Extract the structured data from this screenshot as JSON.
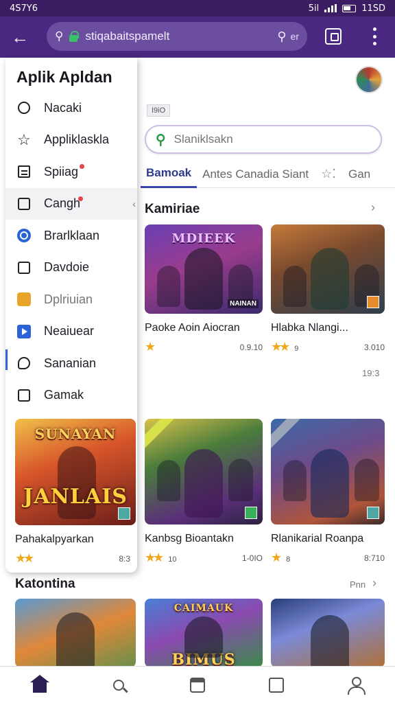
{
  "status": {
    "time": "4S7Y6",
    "clock": "11SD",
    "signal": "5il"
  },
  "toolbar": {
    "url": "stiqabaitspamelt",
    "url_suffix": "er"
  },
  "drawer": {
    "title": "Aplik Apldan",
    "items": [
      {
        "label": "Nacaki",
        "icon": "compass-icon"
      },
      {
        "label": "Appliklaskla",
        "icon": "star-outline-icon"
      },
      {
        "label": "Spiiag",
        "icon": "list-icon"
      },
      {
        "label": "Cangh",
        "icon": "inbox-icon"
      },
      {
        "label": "Brarlklaan",
        "icon": "blue-circle-icon"
      },
      {
        "label": "Davdoie",
        "icon": "download-box-icon"
      },
      {
        "label": "Dplriuian",
        "icon": "game-icon"
      },
      {
        "label": "Neaiuear",
        "icon": "play-icon"
      },
      {
        "label": "Sananian",
        "icon": "chat-bubble-icon"
      },
      {
        "label": "Gamak",
        "icon": "window-icon"
      }
    ],
    "card": {
      "logo": "SUNAYAN",
      "logo2": "JANLAIS",
      "title": "Pahakalpyarkan",
      "meta": "8:3"
    }
  },
  "main": {
    "badge": "I9iO",
    "search_placeholder": "Slaniklsakn",
    "tabs": [
      "Bamoak",
      "Antes Canadia Siant",
      "Gan"
    ],
    "section1": {
      "title": "Kamiriae",
      "row1": [
        {
          "logo": "MDIEEK",
          "tag": "NAINAN",
          "title": "Paoke Aoin Aiocran",
          "rating_note": "",
          "meta": "0.9.10"
        },
        {
          "logo": "",
          "tag": "",
          "title": "Hlabka Nlangi...",
          "rating_note": "9",
          "meta": "3.010"
        }
      ],
      "row_count": "19:3",
      "row2": [
        {
          "title": "Kanbsg Bioantakn",
          "rating_note": "10",
          "meta": "1-0IO"
        },
        {
          "title": "Rlanikarial Roanpa",
          "rating_note": "8",
          "meta": "8:710"
        }
      ]
    },
    "section2": {
      "title": "Katontina",
      "see_all": "Pnn",
      "row": [
        {
          "logo": ""
        },
        {
          "logo": "CAIMAUK",
          "logo2": "BIMUS"
        },
        {
          "logo": ""
        }
      ]
    }
  },
  "colors": {
    "status_bar": "#3a1d63",
    "app_bar": "#4a2780",
    "accent": "#3c46b0",
    "star": "#f0a81c"
  }
}
